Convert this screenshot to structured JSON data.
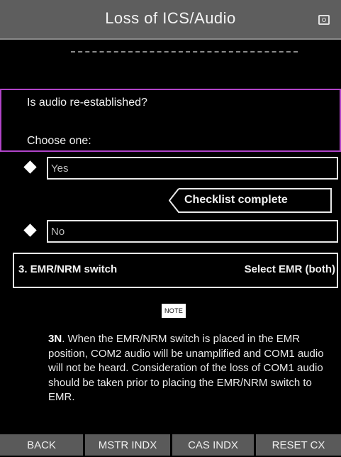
{
  "header": {
    "title": "Loss of ICS/Audio",
    "icon": "display-settings-icon"
  },
  "question": {
    "prompt": "Is audio re-established?",
    "choose": "Choose one:"
  },
  "options": [
    {
      "label": "Yes"
    },
    {
      "label": "No"
    }
  ],
  "result": {
    "label": "Checklist complete"
  },
  "step": {
    "label": "3. EMR/NRM switch",
    "action": "Select EMR (both)"
  },
  "note": {
    "badge": "NOTE",
    "id": "3N",
    "text": ". When the EMR/NRM switch is placed in the EMR position, COM2 audio will be unamplified and COM1 audio will not be heard. Consideration of the loss of COM1 audio should be taken prior to placing the EMR/NRM switch to EMR."
  },
  "footer": {
    "buttons": [
      "BACK",
      "MSTR INDX",
      "CAS INDX",
      "RESET CX"
    ]
  },
  "colors": {
    "title_bar": "#5e5e5e",
    "highlight_border": "#b044c8",
    "background": "#000000",
    "button_bg": "#5a5a5a"
  }
}
